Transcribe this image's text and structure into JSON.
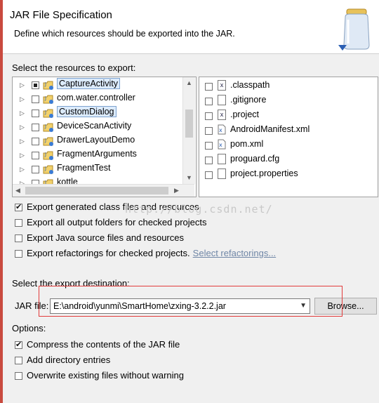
{
  "header": {
    "title": "JAR File Specification",
    "description": "Define which resources should be exported into the JAR."
  },
  "resources": {
    "label": "Select the resources to export:",
    "tree_items": [
      {
        "label": "CaptureActivity",
        "state": "partial",
        "selected": true
      },
      {
        "label": "com.water.controller",
        "state": "unchecked",
        "selected": false
      },
      {
        "label": "CustomDialog",
        "state": "unchecked",
        "selected": true
      },
      {
        "label": "DeviceScanActivity",
        "state": "unchecked",
        "selected": false
      },
      {
        "label": "DrawerLayoutDemo",
        "state": "unchecked",
        "selected": false
      },
      {
        "label": "FragmentArguments",
        "state": "unchecked",
        "selected": false
      },
      {
        "label": "FragmentTest",
        "state": "unchecked",
        "selected": false
      },
      {
        "label": "kottle",
        "state": "unchecked",
        "selected": false
      }
    ],
    "files": [
      {
        "label": ".classpath",
        "icon": "x-file-icon"
      },
      {
        "label": ".gitignore",
        "icon": "text-file-icon"
      },
      {
        "label": ".project",
        "icon": "x-file-icon"
      },
      {
        "label": "AndroidManifest.xml",
        "icon": "xml-file-icon"
      },
      {
        "label": "pom.xml",
        "icon": "xml-file-icon"
      },
      {
        "label": "proguard.cfg",
        "icon": "text-file-icon"
      },
      {
        "label": "project.properties",
        "icon": "text-file-icon"
      }
    ]
  },
  "options_top": [
    {
      "label": "Export generated class files and resources",
      "checked": true
    },
    {
      "label": "Export all output folders for checked projects",
      "checked": false
    },
    {
      "label": "Export Java source files and resources",
      "checked": false
    },
    {
      "label": "Export refactorings for checked projects.",
      "checked": false,
      "link": "Select refactorings..."
    }
  ],
  "watermark": "http://blog.csdn.net/",
  "destination": {
    "label": "Select the export destination:",
    "jar_label": "JAR file:",
    "jar_value": "E:\\android\\yunmi\\SmartHome\\zxing-3.2.2.jar",
    "browse_label": "Browse...",
    "highlight_color": "#e23b3b"
  },
  "options": {
    "label": "Options:",
    "items": [
      {
        "label": "Compress the contents of the JAR file",
        "checked": true
      },
      {
        "label": "Add directory entries",
        "checked": false
      },
      {
        "label": "Overwrite existing files without warning",
        "checked": false
      }
    ]
  }
}
